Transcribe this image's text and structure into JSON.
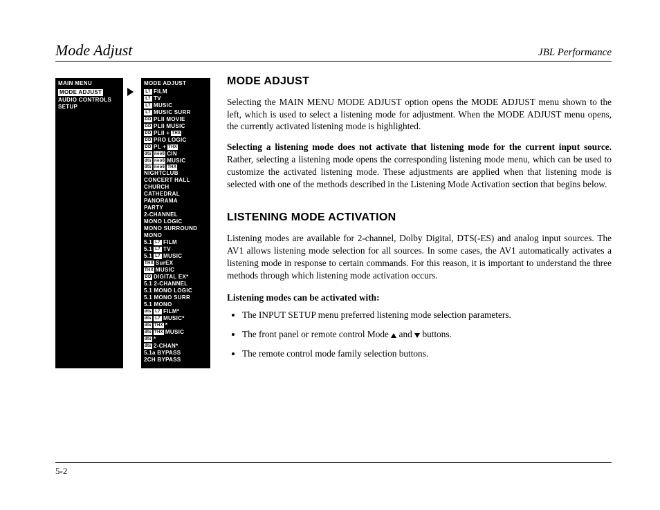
{
  "header": {
    "left": "Mode Adjust",
    "right": "JBL Performance"
  },
  "main_menu": {
    "title": "MAIN MENU",
    "items": [
      "MODE ADJUST",
      "AUDIO CONTROLS",
      "SETUP"
    ],
    "selected_index": 0
  },
  "mode_adjust_menu": {
    "title": "MODE ADJUST",
    "items": [
      {
        "icons": [
          "L7"
        ],
        "label": "FILM"
      },
      {
        "icons": [
          "L7"
        ],
        "label": "TV"
      },
      {
        "icons": [
          "L7"
        ],
        "label": "MUSIC"
      },
      {
        "icons": [
          "L7"
        ],
        "label": "MUSIC SURR"
      },
      {
        "icons": [
          "DD"
        ],
        "label": "PLII MOVIE"
      },
      {
        "icons": [
          "DD"
        ],
        "label": "PLII MUSIC"
      },
      {
        "icons": [
          "DD"
        ],
        "label": "PLII + ",
        "post_icons": [
          "THX"
        ]
      },
      {
        "icons": [
          "DD"
        ],
        "label": "PRO LOGIC"
      },
      {
        "icons": [
          "DD"
        ],
        "label": "PL + ",
        "post_icons": [
          "THX"
        ]
      },
      {
        "icons": [
          "dts",
          "neo6"
        ],
        "label": "CIN"
      },
      {
        "icons": [
          "dts",
          "neo6"
        ],
        "label": "MUSIC"
      },
      {
        "icons": [
          "dts",
          "neo6",
          "THX"
        ],
        "label": ""
      },
      {
        "icons": [],
        "label": "NIGHTCLUB"
      },
      {
        "icons": [],
        "label": "CONCERT HALL"
      },
      {
        "icons": [],
        "label": "CHURCH"
      },
      {
        "icons": [],
        "label": "CATHEDRAL"
      },
      {
        "icons": [],
        "label": "PANORAMA"
      },
      {
        "icons": [],
        "label": "PARTY"
      },
      {
        "icons": [],
        "label": "2-CHANNEL"
      },
      {
        "icons": [],
        "label": "MONO LOGIC"
      },
      {
        "icons": [],
        "label": "MONO SURROUND"
      },
      {
        "icons": [],
        "label": "MONO"
      },
      {
        "icons": [],
        "label": "5.1",
        "post_icons": [
          "L7"
        ],
        "post_label": " FILM"
      },
      {
        "icons": [],
        "label": "5.1",
        "post_icons": [
          "L7"
        ],
        "post_label": " TV"
      },
      {
        "icons": [],
        "label": "5.1",
        "post_icons": [
          "L7"
        ],
        "post_label": " MUSIC"
      },
      {
        "icons": [
          "THX"
        ],
        "label": "SurEX"
      },
      {
        "icons": [
          "THX"
        ],
        "label": "MUSIC"
      },
      {
        "icons": [
          "DD"
        ],
        "label": "DIGITAL EX*"
      },
      {
        "icons": [],
        "label": "5.1 2-CHANNEL"
      },
      {
        "icons": [],
        "label": "5.1 MONO LOGIC"
      },
      {
        "icons": [],
        "label": "5.1 MONO SURR"
      },
      {
        "icons": [],
        "label": "5.1 MONO"
      },
      {
        "icons": [
          "dts",
          "L7"
        ],
        "label": "FILM*"
      },
      {
        "icons": [
          "dts",
          "L7"
        ],
        "label": "MUSIC*"
      },
      {
        "icons": [
          "dts",
          "THX"
        ],
        "label": "*"
      },
      {
        "icons": [
          "dts",
          "THX"
        ],
        "label": "MUSIC"
      },
      {
        "icons": [
          "dts"
        ],
        "label": "*"
      },
      {
        "icons": [
          "dts"
        ],
        "label": "2-CHAN*"
      },
      {
        "icons": [],
        "label": "5.1a BYPASS"
      },
      {
        "icons": [],
        "label": "2CH BYPASS"
      }
    ]
  },
  "sections": {
    "mode_adjust": {
      "heading": "MODE ADJUST",
      "p1": "Selecting the MAIN MENU MODE ADJUST option opens the MODE ADJUST menu shown to the left, which is used to select a listening mode for adjustment. When the MODE ADJUST menu opens, the currently activated listening mode is highlighted.",
      "p2_bold": "Selecting a listening mode does not activate that listening mode for the current input source.",
      "p2_rest": " Rather, selecting a listening mode opens the corresponding listening mode menu, which can be used to customize the activated listening mode. These adjustments are applied when that listening mode is selected with one of the methods described in the Listening Mode Activation section that begins below."
    },
    "listening": {
      "heading": "LISTENING MODE ACTIVATION",
      "p1": "Listening modes are available for 2-channel, Dolby Digital, DTS(-ES) and analog input sources. The AV1 allows listening mode selection for all sources. In some cases, the AV1 automatically activates a listening mode in response to certain commands. For this reason, it is important to understand the three methods through which listening mode activation occurs.",
      "sub": "Listening modes can be activated with:",
      "bullets": [
        "The INPUT SETUP menu preferred listening mode selection parameters.",
        "The front panel or remote control Mode __UP__ and __DOWN__ buttons.",
        "The remote control mode family selection buttons."
      ]
    }
  },
  "footer": {
    "page": "5-2"
  }
}
